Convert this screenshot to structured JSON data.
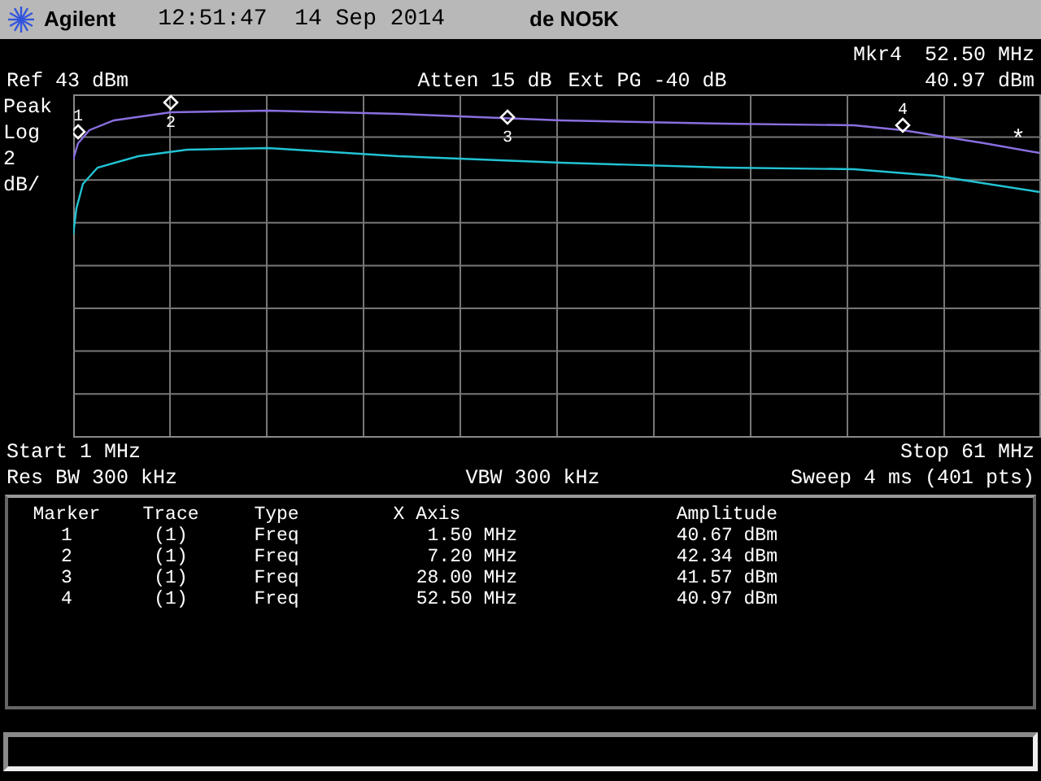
{
  "header": {
    "brand": "Agilent",
    "datetime": "12:51:47  14 Sep 2014",
    "title": "de NO5K"
  },
  "marker_readout": {
    "label": "Mkr4",
    "frequency": "52.50 MHz",
    "amplitude": "40.97 dBm"
  },
  "ref_level": "Ref 43 dBm",
  "atten": "Atten 15 dB",
  "ext_pg": "Ext PG -40 dB",
  "scale_labels": [
    "Peak",
    "Log",
    "2",
    "dB/"
  ],
  "plot": {
    "markers": [
      {
        "label": "1"
      },
      {
        "label": "2"
      },
      {
        "label": "3"
      },
      {
        "label": "4"
      }
    ],
    "symbol": "*"
  },
  "start": "Start 1 MHz",
  "stop": "Stop 61 MHz",
  "rbw": "Res BW 300 kHz",
  "vbw": "VBW 300 kHz",
  "sweep": "Sweep 4 ms (401 pts)",
  "marker_table": {
    "columns": [
      "Marker",
      "Trace",
      "Type",
      "X Axis",
      "Amplitude"
    ],
    "rows": [
      [
        "1",
        "(1)",
        "Freq",
        "1.50 MHz",
        "40.67 dBm"
      ],
      [
        "2",
        "(1)",
        "Freq",
        "7.20 MHz",
        "42.34 dBm"
      ],
      [
        "3",
        "(1)",
        "Freq",
        "28.00 MHz",
        "41.57 dBm"
      ],
      [
        "4",
        "(1)",
        "Freq",
        "52.50 MHz",
        "40.97 dBm"
      ]
    ]
  }
}
